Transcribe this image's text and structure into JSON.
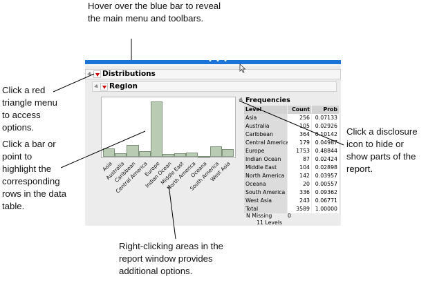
{
  "callouts": {
    "top": [
      "Hover over the blue bar to reveal",
      "the main menu and toolbars."
    ],
    "red_triangle": [
      "Click a red",
      "triangle menu",
      "to access",
      "options."
    ],
    "bar_click": [
      "Click a bar or",
      "point to",
      "highlight the",
      "corresponding",
      "rows in the data",
      "table."
    ],
    "disclosure": [
      "Click a disclosure",
      "icon to hide or",
      "show parts of the",
      "report."
    ],
    "right_click": [
      "Right-clicking areas in the",
      "report window provides",
      "additional options."
    ]
  },
  "window": {
    "blue_bar_dots": "• • •",
    "distributions_title": "Distributions",
    "region_title": "Region",
    "frequencies_title": "Frequencies"
  },
  "frequencies": {
    "headers": {
      "level": "Level",
      "count": "Count",
      "prob": "Prob"
    },
    "rows": [
      {
        "level": "Asia",
        "count": "256",
        "prob": "0.07133"
      },
      {
        "level": "Australia",
        "count": "105",
        "prob": "0.02926"
      },
      {
        "level": "Caribbean",
        "count": "364",
        "prob": "0.10142"
      },
      {
        "level": "Central America",
        "count": "179",
        "prob": "0.04987"
      },
      {
        "level": "Europe",
        "count": "1753",
        "prob": "0.48844"
      },
      {
        "level": "Indian Ocean",
        "count": "87",
        "prob": "0.02424"
      },
      {
        "level": "Middle East",
        "count": "104",
        "prob": "0.02898"
      },
      {
        "level": "North America",
        "count": "142",
        "prob": "0.03957"
      },
      {
        "level": "Oceana",
        "count": "20",
        "prob": "0.00557"
      },
      {
        "level": "South America",
        "count": "336",
        "prob": "0.09362"
      },
      {
        "level": "West Asia",
        "count": "243",
        "prob": "0.06771"
      },
      {
        "level": "Total",
        "count": "3589",
        "prob": "1.00000"
      }
    ],
    "n_missing_label": "N Missing",
    "n_missing_value": "0",
    "levels_text": "11  Levels"
  },
  "chart_data": {
    "type": "bar",
    "categories": [
      "Asia",
      "Australia",
      "Caribbean",
      "Central America",
      "Europe",
      "Indian Ocean",
      "Middle East",
      "North America",
      "Oceana",
      "South America",
      "West Asia"
    ],
    "values": [
      256,
      105,
      364,
      179,
      1753,
      87,
      104,
      142,
      20,
      336,
      243
    ],
    "ylim": [
      0,
      1800
    ],
    "grid": false,
    "colors": {
      "fill": "#b9ccb3",
      "stroke": "#7c8f78"
    }
  },
  "colors": {
    "blue_bar": "#1a73d9",
    "red_triangle": "#d40000",
    "panel_bg": "#ececec",
    "level_col_bg": "#dcdcdc"
  }
}
